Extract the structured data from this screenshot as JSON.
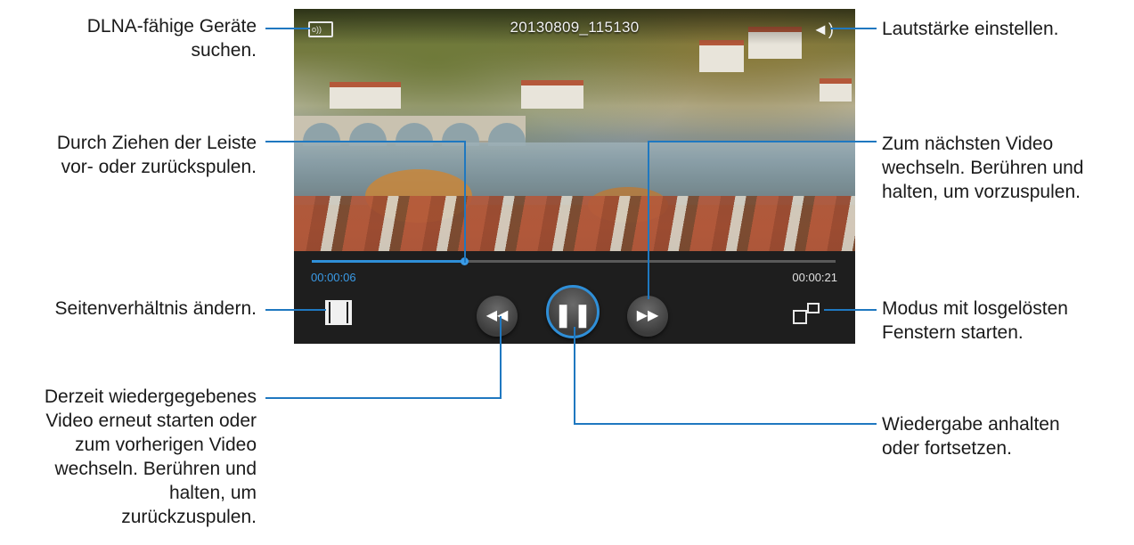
{
  "player": {
    "video_title": "20130809_115130",
    "elapsed_time": "00:00:06",
    "total_time": "00:00:21",
    "progress_fraction": 0.29,
    "accent_color": "#2f8fd8"
  },
  "callouts": {
    "dlna_line1": "DLNA-fähige Geräte",
    "dlna_line2": "suchen.",
    "seek_line1": "Durch Ziehen der Leiste",
    "seek_line2": "vor- oder zurückspulen.",
    "ratio": "Seitenverhältnis ändern.",
    "prev_line1": "Derzeit wiedergegebenes",
    "prev_line2": "Video erneut starten oder",
    "prev_line3": "zum vorherigen Video",
    "prev_line4": "wechseln. Berühren und",
    "prev_line5": "halten, um",
    "prev_line6": "zurückzuspulen.",
    "volume": "Lautstärke einstellen.",
    "next_line1": "Zum nächsten Video",
    "next_line2": "wechseln. Berühren und",
    "next_line3": "halten, um vorzuspulen.",
    "popup_line1": "Modus mit losgelösten",
    "popup_line2": "Fenstern starten.",
    "pause_line1": "Wiedergabe anhalten",
    "pause_line2": "oder fortsetzen."
  },
  "icons": [
    "dlna-icon",
    "volume-icon",
    "aspect-ratio-icon",
    "previous-icon",
    "pause-icon",
    "next-icon",
    "popup-window-icon"
  ]
}
